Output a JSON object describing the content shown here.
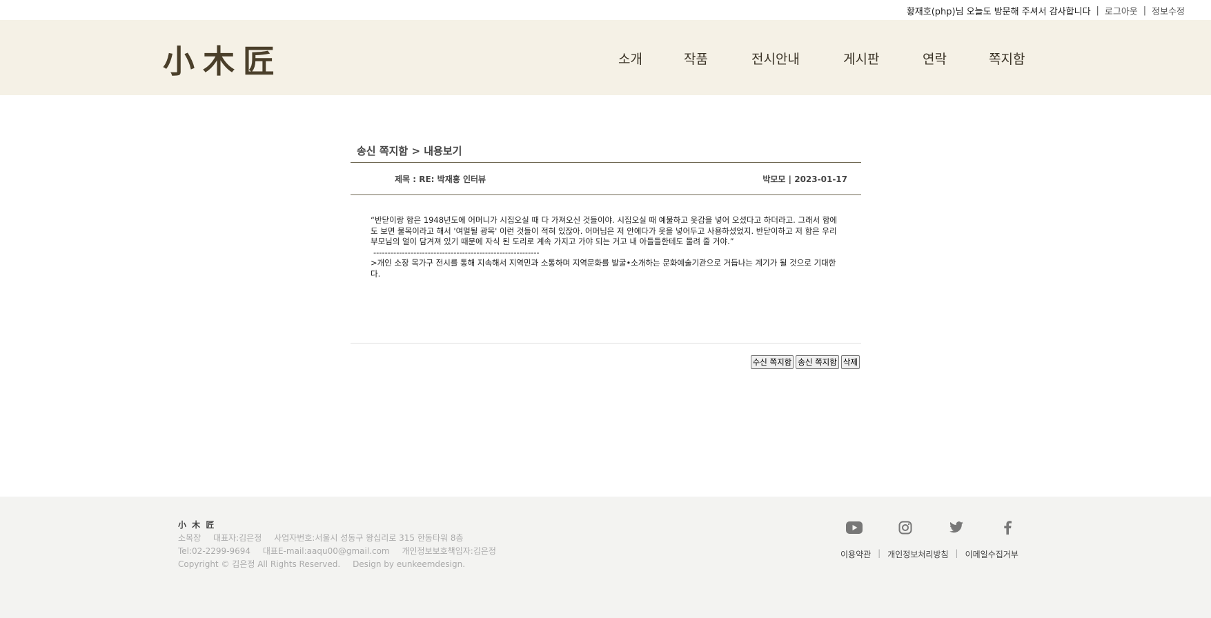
{
  "topbar": {
    "welcome": "황재호(php)님 오늘도 방문해 주셔서 감사합니다",
    "logout": "로그아웃",
    "profile_edit": "정보수정",
    "sep": "|"
  },
  "header": {
    "logo": "小木匠",
    "nav": [
      "소개",
      "작품",
      "전시안내",
      "게시판",
      "연락",
      "쪽지함"
    ]
  },
  "message": {
    "breadcrumb": "송신 쪽지함 > 내용보기",
    "subject": "제목 : RE: 박재홍 인터뷰",
    "author": "박모모",
    "date": "2023-01-17",
    "meta_sep": "|",
    "body_lines": [
      "“반닫이랑 함은 1948년도에 어머니가 시집오실 때 다 가져오신 것들이야. 시집오실 때 예물하고 옷감을 넣어 오셨다고 하더라고. 그래서 함에도 보면 물목이라고 해서 '여멀될 광목' 이런 것들이 적혀 있잖아. 어머님은 저 안에다가 옷을 넣어두고 사용하셨었지. 반닫이하고 저 함은 우리 부모님의 얼이 담겨져 있기 때문에 자식 된 도리로 계속 가지고 가야 되는 거고 내 아들들한테도 물려 줄 거야.”"
    ],
    "dashes": "----------------------------------------------------------",
    "body_after": ">개인 소장 목가구 전시를 통해 지속해서 지역민과 소통하며 지역문화를 발굴•소개하는 문화예술기관으로 거듭나는 계기가 될 것으로 기대한다.",
    "buttons": {
      "inbox": "수신 쪽지함",
      "outbox": "송신 쪽지함",
      "delete": "삭제"
    }
  },
  "footer": {
    "logo": "小 木 匠",
    "line1": [
      "소목장",
      "대표자:김은정",
      "사업자번호:서울시 성동구 왕십리로 315 한동타워 8층"
    ],
    "line2": [
      "Tel:02-2299-9694",
      "대표E-mail:aaqu00@gmail.com",
      "개인정보보호책임자:김은정"
    ],
    "line3": [
      "Copyright © 김은정  All Rights Reserved.",
      "Design by eunkeemdesign."
    ],
    "social_icons": [
      "youtube-icon",
      "instagram-icon",
      "twitter-icon",
      "facebook-icon"
    ],
    "policy": [
      "이용약관",
      "개인정보처리방침",
      "이메일수집거부"
    ],
    "policy_sep": "|"
  },
  "colors": {
    "header_bg": "#f5f1e6",
    "footer_bg": "#f3f3f1",
    "logo": "#4a3f2a"
  }
}
